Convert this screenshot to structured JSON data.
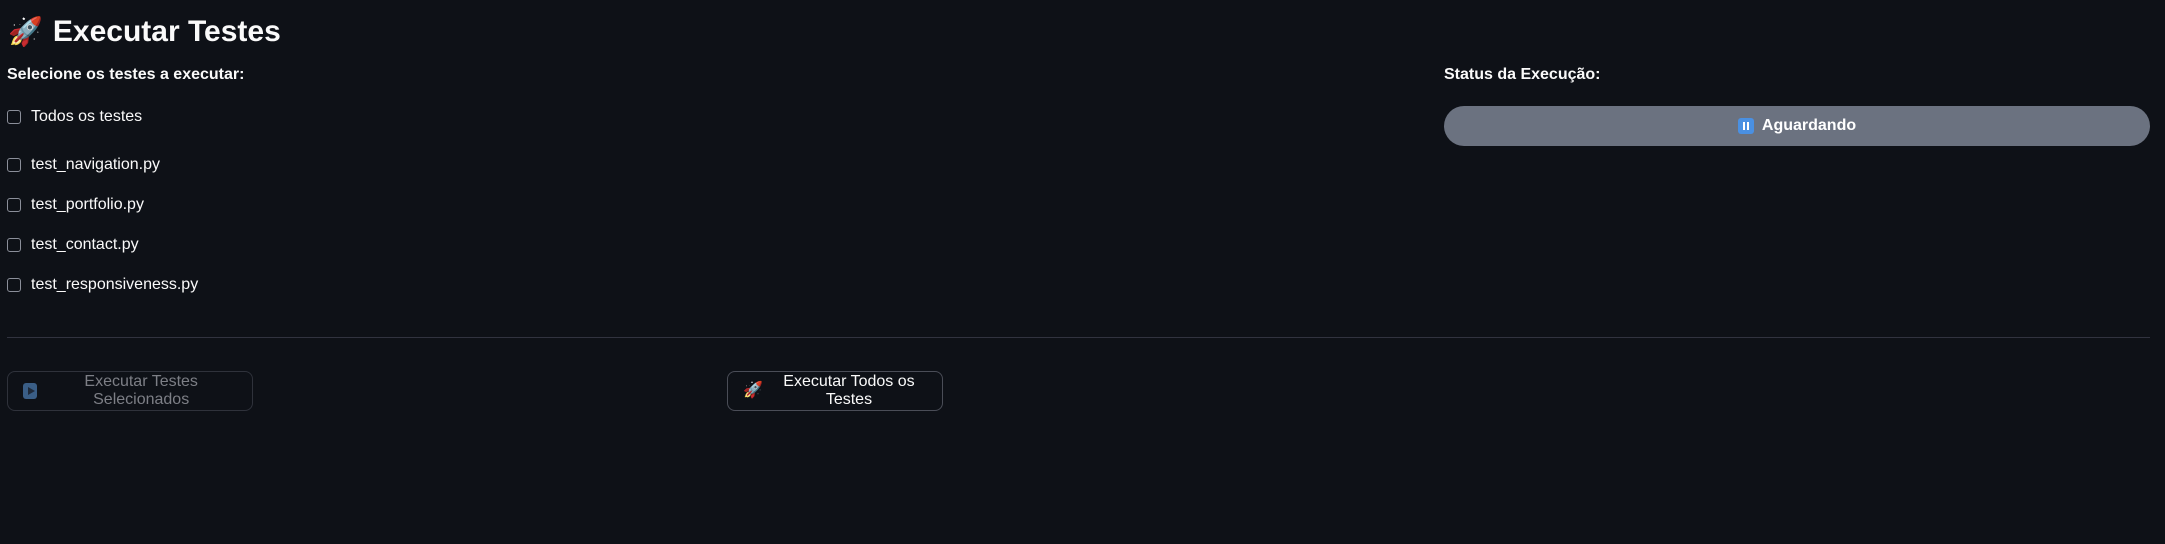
{
  "header": {
    "icon": "rocket-icon",
    "icon_glyph": "🚀",
    "title": "Executar Testes"
  },
  "test_selection": {
    "label": "Selecione os testes a executar:",
    "options": [
      {
        "label": "Todos os testes",
        "checked": false
      },
      {
        "label": "test_navigation.py",
        "checked": false
      },
      {
        "label": "test_portfolio.py",
        "checked": false
      },
      {
        "label": "test_contact.py",
        "checked": false
      },
      {
        "label": "test_responsiveness.py",
        "checked": false
      }
    ]
  },
  "status": {
    "label": "Status da Execução:",
    "icon": "pause-icon",
    "value": "Aguardando",
    "color": "#6b7280"
  },
  "actions": {
    "run_selected": {
      "label": "Executar Testes Selecionados",
      "icon": "play-icon",
      "disabled": true
    },
    "run_all": {
      "label": "Executar Todos os Testes",
      "icon": "rocket-icon",
      "icon_glyph": "🚀",
      "disabled": false
    }
  },
  "colors": {
    "background": "#0e1117",
    "text": "#fafafa",
    "status_pill": "#6b7280",
    "divider": "#31333f"
  }
}
